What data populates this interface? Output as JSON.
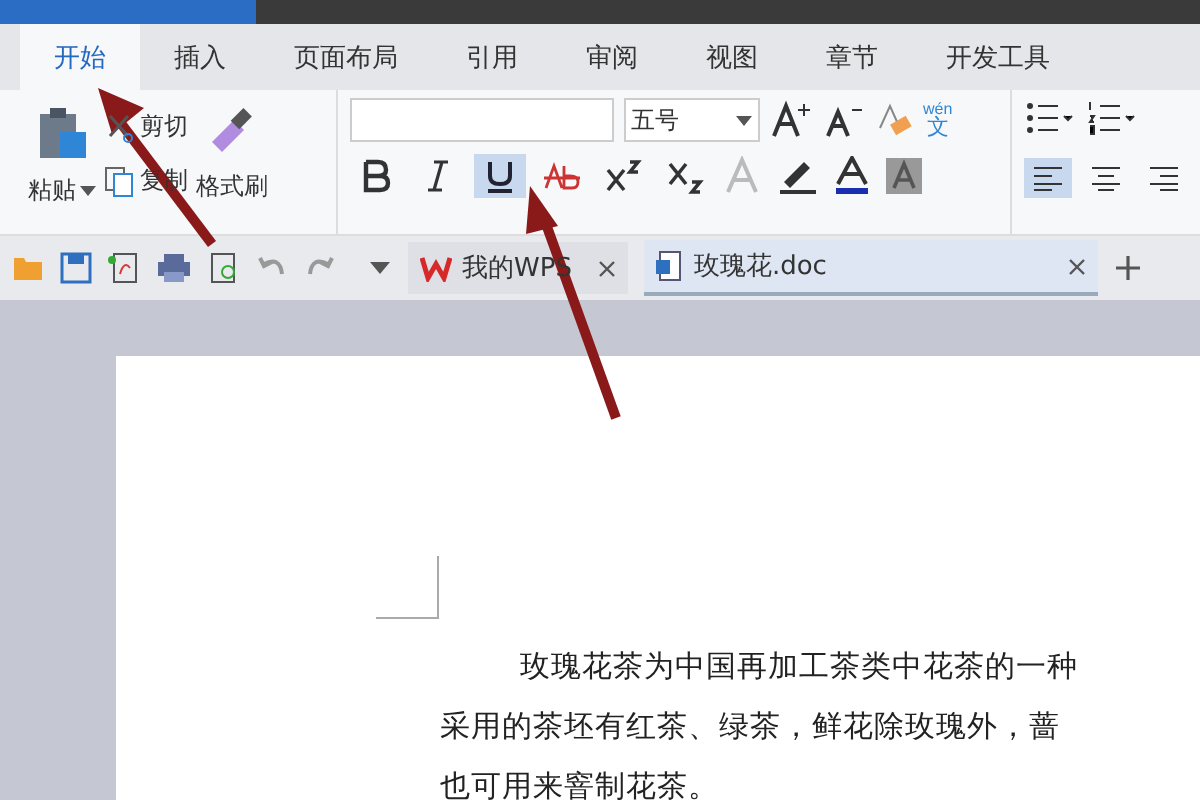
{
  "tabs": [
    {
      "label": "开始",
      "selected": true
    },
    {
      "label": "插入",
      "selected": false
    },
    {
      "label": "页面布局",
      "selected": false
    },
    {
      "label": "引用",
      "selected": false
    },
    {
      "label": "审阅",
      "selected": false
    },
    {
      "label": "视图",
      "selected": false
    },
    {
      "label": "章节",
      "selected": false
    },
    {
      "label": "开发工具",
      "selected": false
    }
  ],
  "clipboard": {
    "paste": "粘贴",
    "cut": "剪切",
    "copy": "复制",
    "format_painter": "格式刷"
  },
  "font": {
    "size_value": "五号",
    "pinyin_top": "wén",
    "pinyin_bottom": "文"
  },
  "format_buttons": [
    {
      "kind": "bold",
      "selected": false
    },
    {
      "kind": "italic",
      "selected": false
    },
    {
      "kind": "underline",
      "selected": true
    },
    {
      "kind": "strike",
      "selected": false
    },
    {
      "kind": "superscript",
      "selected": false
    },
    {
      "kind": "subscript",
      "selected": false
    }
  ],
  "align_buttons": [
    {
      "kind": "left",
      "selected": true
    },
    {
      "kind": "center",
      "selected": false
    },
    {
      "kind": "right",
      "selected": false
    }
  ],
  "doc_tabs": [
    {
      "label": "我的WPS",
      "kind": "home",
      "selected": false
    },
    {
      "label": "玫瑰花.doc",
      "kind": "doc",
      "selected": true
    }
  ],
  "paragraph": {
    "lines": [
      "玫瑰花茶为中国再加工茶类中花茶的一种",
      "采用的茶坯有红茶、绿茶，鲜花除玫瑰外，蔷",
      "也可用来窨制花茶。"
    ]
  }
}
